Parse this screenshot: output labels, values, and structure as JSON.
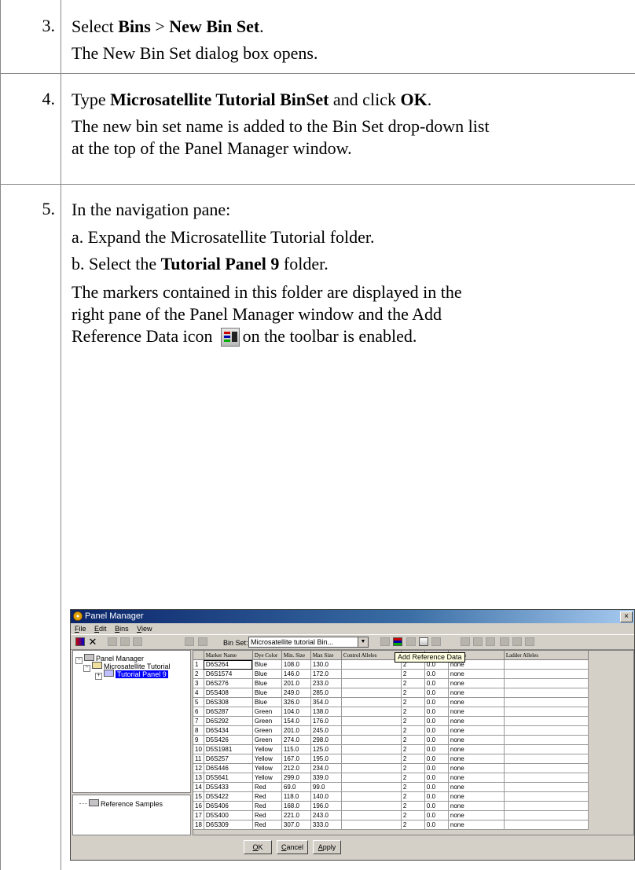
{
  "steps": [
    {
      "number": "3.",
      "line1": [
        "Select ",
        "Bins",
        " > ",
        "New Bin Set",
        "."
      ],
      "line2": "The New Bin Set dialog box opens."
    },
    {
      "number": "4.",
      "line1": [
        "Type ",
        "Microsatellite Tutorial BinSet",
        " and click ",
        "OK",
        "."
      ],
      "line2a": "The new bin set name is added to the Bin Set drop-down list",
      "line2b": "at the top of the Panel Manager window."
    },
    {
      "number": "5.",
      "line1": "In the navigation pane:",
      "a": "a. Expand the Microsatellite Tutorial folder.",
      "b": [
        "b. Select the ",
        "Tutorial Panel 9",
        "  folder."
      ],
      "p1": "The markers contained in this folder are displayed in the",
      "p2": "right pane of the Panel Manager window and the Add",
      "p3a": "Reference Data icon",
      "p3b": "on the toolbar is enabled."
    }
  ],
  "window": {
    "title": "Panel Manager",
    "close": "×",
    "menu": [
      "File",
      "Edit",
      "Bins",
      "View"
    ],
    "menu_underline": [
      "F",
      "E",
      "B",
      "V"
    ],
    "bin_set_label": "Bin Set:",
    "bin_set_value": "Microsatellite tutorial Bin...",
    "tooltip": "Add Reference Data",
    "tree": {
      "root": "Panel Manager",
      "folder": "Microsatellite Tutorial",
      "panel": "Tutorial Panel 9",
      "reference": "Reference Samples"
    },
    "columns": [
      "",
      "Marker Name",
      "Dye Color",
      "Min. Size",
      "Max Size",
      "Control Alleles",
      "",
      "",
      "nments",
      "Ladder Alleles"
    ],
    "rows": [
      [
        "1",
        "D6S264",
        "Blue",
        "108.0",
        "130.0",
        "",
        "2",
        "0.0",
        "none",
        ""
      ],
      [
        "2",
        "D6S1574",
        "Blue",
        "146.0",
        "172.0",
        "",
        "2",
        "0.0",
        "none",
        ""
      ],
      [
        "3",
        "D6S276",
        "Blue",
        "201.0",
        "233.0",
        "",
        "2",
        "0.0",
        "none",
        ""
      ],
      [
        "4",
        "D5S408",
        "Blue",
        "249.0",
        "285.0",
        "",
        "2",
        "0.0",
        "none",
        ""
      ],
      [
        "5",
        "D6S308",
        "Blue",
        "326.0",
        "354.0",
        "",
        "2",
        "0.0",
        "none",
        ""
      ],
      [
        "6",
        "D6S287",
        "Green",
        "104.0",
        "138.0",
        "",
        "2",
        "0.0",
        "none",
        ""
      ],
      [
        "7",
        "D6S292",
        "Green",
        "154.0",
        "176.0",
        "",
        "2",
        "0.0",
        "none",
        ""
      ],
      [
        "8",
        "D6S434",
        "Green",
        "201.0",
        "245.0",
        "",
        "2",
        "0.0",
        "none",
        ""
      ],
      [
        "9",
        "D5S426",
        "Green",
        "274.0",
        "298.0",
        "",
        "2",
        "0.0",
        "none",
        ""
      ],
      [
        "10",
        "D5S1981",
        "Yellow",
        "115.0",
        "125.0",
        "",
        "2",
        "0.0",
        "none",
        ""
      ],
      [
        "11",
        "D6S257",
        "Yellow",
        "167.0",
        "195.0",
        "",
        "2",
        "0.0",
        "none",
        ""
      ],
      [
        "12",
        "D6S446",
        "Yellow",
        "212.0",
        "234.0",
        "",
        "2",
        "0.0",
        "none",
        ""
      ],
      [
        "13",
        "D5S641",
        "Yellow",
        "299.0",
        "339.0",
        "",
        "2",
        "0.0",
        "none",
        ""
      ],
      [
        "14",
        "D5S433",
        "Red",
        "69.0",
        "99.0",
        "",
        "2",
        "0.0",
        "none",
        ""
      ],
      [
        "15",
        "D5S422",
        "Red",
        "118.0",
        "140.0",
        "",
        "2",
        "0.0",
        "none",
        ""
      ],
      [
        "16",
        "D6S406",
        "Red",
        "168.0",
        "196.0",
        "",
        "2",
        "0.0",
        "none",
        ""
      ],
      [
        "17",
        "D5S400",
        "Red",
        "221.0",
        "243.0",
        "",
        "2",
        "0.0",
        "none",
        ""
      ],
      [
        "18",
        "D6S309",
        "Red",
        "307.0",
        "333.0",
        "",
        "2",
        "0.0",
        "none",
        ""
      ]
    ],
    "buttons": {
      "ok": "OK",
      "ok_u": "O",
      "cancel": "Cancel",
      "cancel_u": "C",
      "apply": "Apply",
      "apply_u": "A"
    },
    "colors": {
      "title_start": "#0a246a",
      "title_end": "#a6caf0",
      "selection": "#0000ff",
      "chrome": "#d4d0c8"
    }
  }
}
